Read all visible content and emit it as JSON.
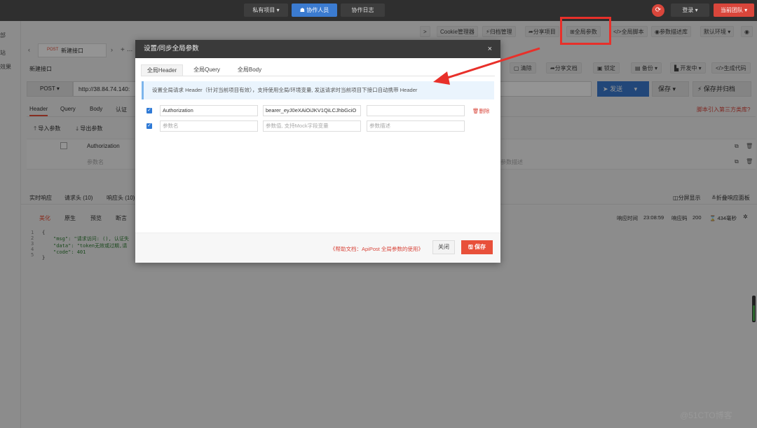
{
  "topbar": {
    "private_project": "私有项目",
    "collaborators": "协作人员",
    "collab_log": "协作日志",
    "login": "登录",
    "current_team": "当前团队"
  },
  "sidebar": {
    "item1": "部",
    "item2": "站",
    "item3": "效果"
  },
  "toolbar": {
    "expand": ">",
    "cookie_manager": "Cookie管理器",
    "archive_manager": "归档管理",
    "share_project": "分享项目",
    "global_params": "全局参数",
    "global_script": "全局脚本",
    "param_library": "参数描述库",
    "default_env": "默认环境"
  },
  "tabs": {
    "method_tag": "POST",
    "new_api": "新建接口",
    "plus": "+",
    "more": "..."
  },
  "request": {
    "name": "新建接口",
    "method": "POST",
    "url": "http://38.84.74.140:",
    "clear": "清除",
    "share_doc": "分享文档",
    "lock": "锁定",
    "backup": "备份",
    "dev_status": "开发中",
    "gen_code": "生成代码",
    "send": "发送",
    "save": "保存",
    "save_archive": "保存并归档",
    "third_party_lib": "脚本引入第三方类库?"
  },
  "req_tabs": [
    "Header",
    "Query",
    "Body",
    "认证"
  ],
  "req_actions": {
    "import": "导入参数",
    "export": "导出参数"
  },
  "header_table": {
    "row1_key": "Authorization",
    "row2_placeholder": "参数名",
    "desc_placeholder": "参数描述"
  },
  "response": {
    "tabs": [
      "实时响应",
      "请求头 (10)",
      "响应头 (10)"
    ],
    "sub_tabs": [
      "美化",
      "原生",
      "预览",
      "断言"
    ],
    "split_view": "分屏显示",
    "collapse_panel": "折叠响应面板",
    "resp_time_label": "响应时间",
    "resp_time": "23:08:59",
    "status_label": "响应码",
    "status": "200",
    "duration": "434毫秒"
  },
  "code": {
    "lines": [
      "1",
      "2",
      "3",
      "4",
      "5"
    ],
    "l1": "{",
    "l2": "\"msg\": \"请求访问: (), 认证失",
    "l3": "\"data\": \"token无效或过期,请",
    "l4": "\"code\": 401",
    "l5": "}"
  },
  "modal": {
    "title": "设置/同步全局参数",
    "close": "×",
    "tabs": [
      "全局Header",
      "全局Query",
      "全局Body"
    ],
    "info": "设置全局请求 Header（针对当前项目有效），支持使用全局/环境变量, 发送请求时当前项目下接口自动携带 Header",
    "row1": {
      "key": "Authorization",
      "value": "bearer_eyJ0eXAiOiJKV1QiLCJhbGciO",
      "desc": "",
      "delete": "删除"
    },
    "row2": {
      "key_placeholder": "参数名",
      "value_placeholder": "参数值, 支持Mock字段变量",
      "desc_placeholder": "参数描述"
    },
    "help": "《帮助文档：ApiPost 全局参数的使用》",
    "close_btn": "关闭",
    "save_btn": "保存"
  },
  "watermark": "@51CTO博客",
  "colors": {
    "accent": "#2f7ad6",
    "danger": "#e8503a",
    "annotation": "#e8302a"
  }
}
